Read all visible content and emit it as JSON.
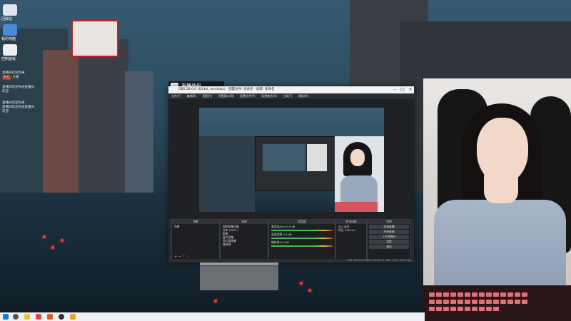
{
  "desktop": {
    "icons": [
      {
        "name": "recycle-bin-icon",
        "label": "回收站",
        "color": "#dfe6ee"
      },
      {
        "name": "app-icon-1",
        "label": "我的电脑",
        "color": "#4b89d6"
      },
      {
        "name": "app-icon-2",
        "label": "控制面板",
        "color": "#f0f0f0"
      }
    ]
  },
  "chat": {
    "lines": [
      {
        "user": "",
        "text": "直播间欢迎你来",
        "badge": ""
      },
      {
        "user": "",
        "text": "主播",
        "badge": "粉丝"
      },
      {
        "user": "",
        "text": "直播间欢迎你进直播间",
        "badge": ""
      },
      {
        "user": "",
        "text": "欢迎",
        "badge": ""
      },
      {
        "user": "",
        "text": "直播间欢迎你来",
        "badge": ""
      },
      {
        "user": "",
        "text": "直播间欢迎你进直播间",
        "badge": ""
      },
      {
        "user": "",
        "text": "欢迎",
        "badge": ""
      }
    ]
  },
  "obs": {
    "brand": "直播伴侣",
    "title": "OBS 28.0.0 (64-bit, windows) - 配置文件: 未命名 - 场景: 未命名",
    "menu": [
      "文件(F)",
      "编辑(E)",
      "视图(V)",
      "停靠窗口(D)",
      "配置文件(P)",
      "场景集合(S)",
      "工具(T)",
      "帮助(H)"
    ],
    "docks": {
      "scenes": {
        "title": "场景",
        "items": [
          "场景"
        ]
      },
      "sources": {
        "title": "来源",
        "items": [
          "视频采集设备",
          "文本 (GDI+)",
          "图像",
          "窗口采集",
          "显示器采集",
          "媒体源"
        ]
      },
      "mixer": {
        "title": "混音器",
        "items": [
          {
            "label": "麦克风/Aux",
            "db": "0.0 dB"
          },
          {
            "label": "桌面音频",
            "db": "0.0 dB"
          },
          {
            "label": "媒体源",
            "db": "0.0 dB"
          }
        ]
      },
      "transitions": {
        "title": "转场动画",
        "type": "淡入淡出",
        "duration_label": "时长",
        "duration": "300 ms"
      },
      "controls": {
        "title": "控制",
        "buttons": [
          "开始直播",
          "开始录制",
          "工作室模式",
          "设置",
          "退出"
        ]
      }
    },
    "status": "LIVE: 00:00:00  REC: 00:00:00  CPU: 2.1%, 60.00 fps"
  },
  "taskbar": {
    "icons": [
      {
        "name": "windows-start-icon",
        "color": "#1e78d6"
      },
      {
        "name": "search-icon",
        "color": "#555555"
      },
      {
        "name": "file-explorer-icon",
        "color": "#f1c232"
      },
      {
        "name": "app-icon-a",
        "color": "#d84a4a"
      },
      {
        "name": "app-icon-b",
        "color": "#e05a2b"
      },
      {
        "name": "app-icon-c",
        "color": "#333333"
      },
      {
        "name": "app-icon-d",
        "color": "#e8a530"
      }
    ]
  }
}
